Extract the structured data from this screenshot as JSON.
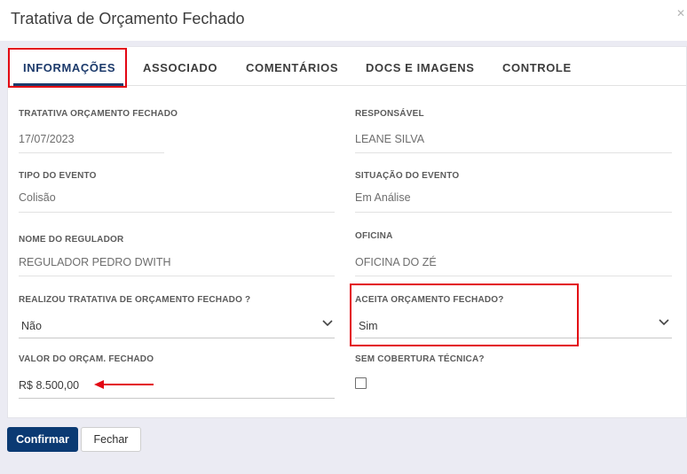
{
  "window": {
    "title": "Tratativa de Orçamento Fechado",
    "close_icon": "close-icon"
  },
  "tabs": [
    {
      "label": "INFORMAÇÕES",
      "active": true
    },
    {
      "label": "ASSOCIADO",
      "active": false
    },
    {
      "label": "COMENTÁRIOS",
      "active": false
    },
    {
      "label": "DOCS E IMAGENS",
      "active": false
    },
    {
      "label": "CONTROLE",
      "active": false
    }
  ],
  "form": {
    "tratativa": {
      "label": "TRATATIVA ORÇAMENTO FECHADO",
      "value": "17/07/2023"
    },
    "responsavel": {
      "label": "RESPONSÁVEL",
      "value": "LEANE SILVA"
    },
    "tipo_evento": {
      "label": "TIPO DO EVENTO",
      "value": "Colisão"
    },
    "situacao_evento": {
      "label": "SITUAÇÃO DO EVENTO",
      "value": "Em Análise"
    },
    "nome_regulador": {
      "label": "NOME DO REGULADOR",
      "value": "REGULADOR PEDRO DWITH"
    },
    "oficina": {
      "label": "OFICINA",
      "value": "OFICINA DO ZÉ"
    },
    "realizou_tratativa": {
      "label": "REALIZOU TRATATIVA DE ORÇAMENTO FECHADO ?",
      "value": "Não"
    },
    "aceita_orcamento": {
      "label": "ACEITA ORÇAMENTO FECHADO?",
      "value": "Sim"
    },
    "valor_orcamento": {
      "label": "VALOR DO ORÇAM. FECHADO",
      "value": "R$ 8.500,00"
    },
    "sem_cobertura": {
      "label": "SEM COBERTURA TÉCNICA?",
      "checked": false
    }
  },
  "buttons": {
    "confirm": "Confirmar",
    "close": "Fechar"
  },
  "colors": {
    "primary": "#0b3a73",
    "highlight": "#e30613",
    "active_tab": "#1c3a6b"
  }
}
